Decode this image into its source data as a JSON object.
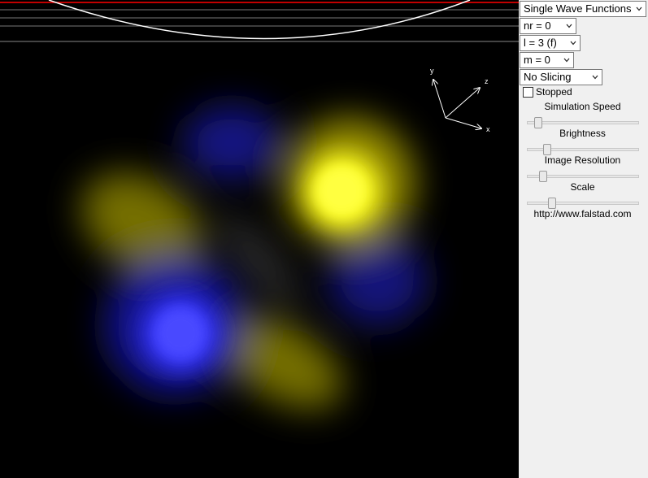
{
  "view_type": {
    "selected": "Single Wave Functions"
  },
  "nr": {
    "selected": "nr = 0"
  },
  "l": {
    "selected": "l = 3 (f)"
  },
  "m": {
    "selected": "m = 0"
  },
  "slicing": {
    "selected": "No Slicing"
  },
  "stopped": {
    "label": "Stopped",
    "checked": false
  },
  "sliders": [
    {
      "label": "Simulation Speed",
      "value": 0.07
    },
    {
      "label": "Brightness",
      "value": 0.16
    },
    {
      "label": "Image Resolution",
      "value": 0.12
    },
    {
      "label": "Scale",
      "value": 0.2
    }
  ],
  "link": "http://www.falstad.com",
  "axes": {
    "x": "x",
    "y": "y",
    "z": "z"
  },
  "colors": {
    "positive_phase": "#ffff00",
    "negative_phase": "#3333ff",
    "energy_curve": "#ffffff",
    "ground_line": "#ff0000"
  }
}
